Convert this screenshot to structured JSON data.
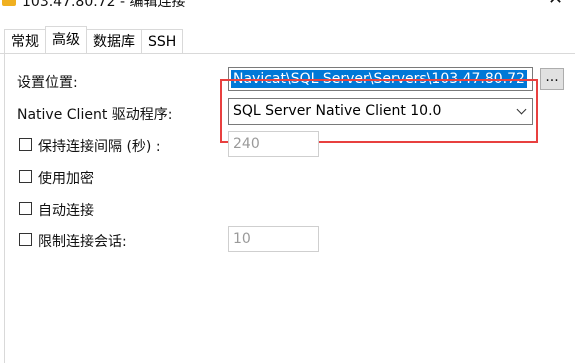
{
  "window": {
    "title": "103.47.80.72 - 编辑连接",
    "close_glyph": "✕"
  },
  "tabs": [
    {
      "label": "常规",
      "active": false
    },
    {
      "label": "高级",
      "active": true
    },
    {
      "label": "数据库",
      "active": false
    },
    {
      "label": "SSH",
      "active": false
    }
  ],
  "form": {
    "settings_location": {
      "label": "设置位置:",
      "value": "Navicat\\SQL Server\\Servers\\103.47.80.72",
      "browse_label": "..."
    },
    "native_client": {
      "label": "Native Client 驱动程序:",
      "selected": "SQL Server Native Client 10.0"
    },
    "keepalive": {
      "label": "保持连接间隔 (秒) :",
      "checked": false,
      "value": "240"
    },
    "encryption": {
      "label": "使用加密",
      "checked": false
    },
    "auto_connect": {
      "label": "自动连接",
      "checked": false
    },
    "limit_sessions": {
      "label": "限制连接会话:",
      "checked": false,
      "value": "10"
    }
  },
  "colors": {
    "selection_bg": "#0078d7",
    "highlight_border": "#e8403f"
  }
}
